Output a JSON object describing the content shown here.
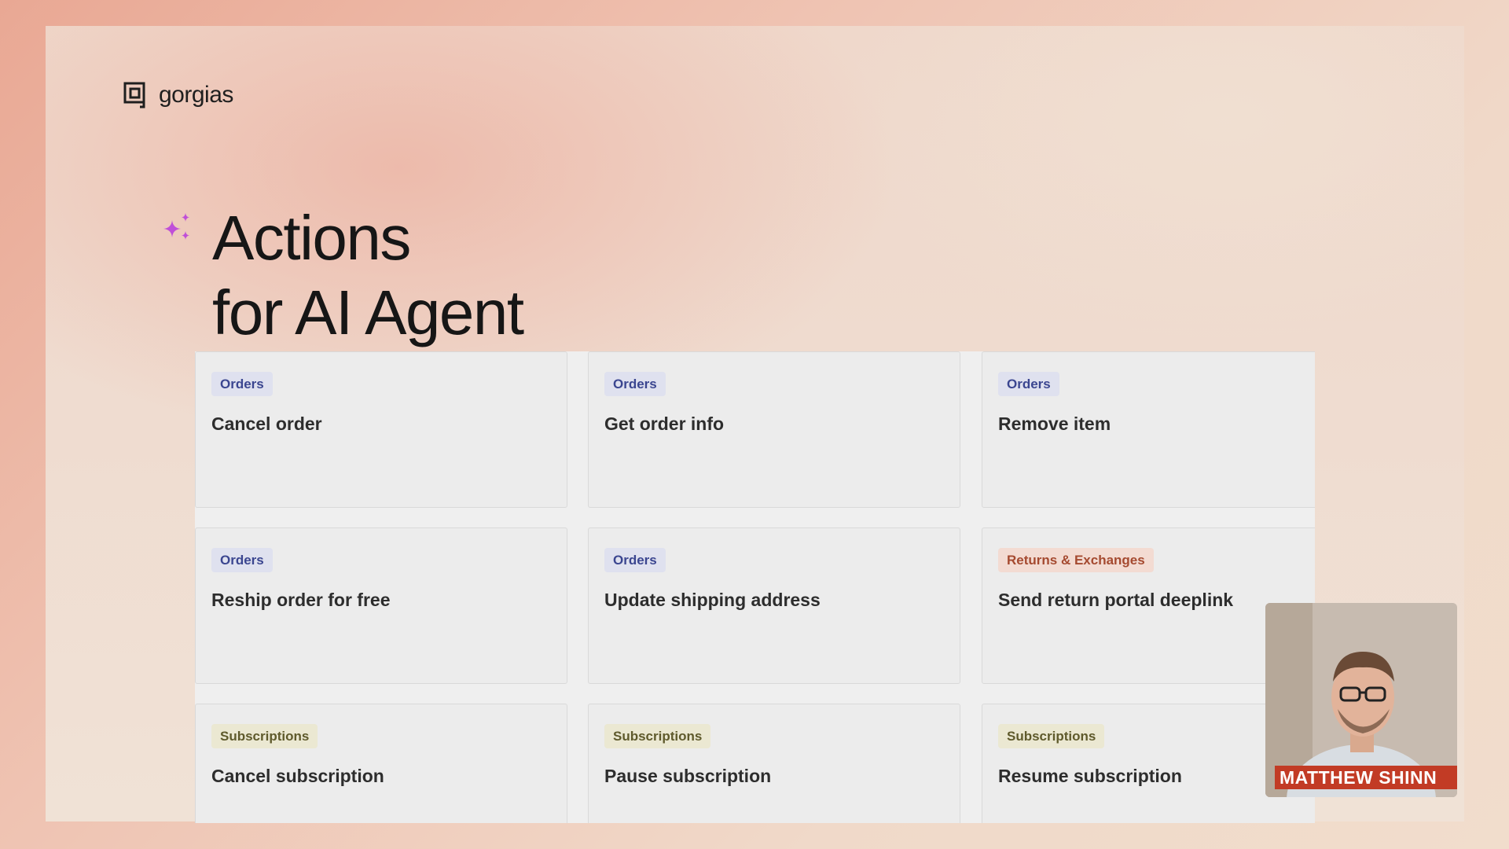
{
  "brand": {
    "name": "gorgias",
    "logo_icon": "gorgias-logo-icon"
  },
  "heading": {
    "line1": "Actions",
    "line2": "for AI Agent",
    "icon": "sparkle-icon"
  },
  "colors": {
    "sparkle": "#c04fd8",
    "tag_orders_bg": "#dfe1ef",
    "tag_orders_fg": "#3b4690",
    "tag_returns_bg": "#f3dbd2",
    "tag_returns_fg": "#a54a30",
    "tag_subs_bg": "#ebe8d2",
    "tag_subs_fg": "#5f5a2c",
    "name_banner": "#c23b25"
  },
  "cards": [
    {
      "tag": "Orders",
      "title": "Cancel order"
    },
    {
      "tag": "Orders",
      "title": "Get order info"
    },
    {
      "tag": "Orders",
      "title": "Remove item"
    },
    {
      "tag": "Orders",
      "title": "Reship order for free"
    },
    {
      "tag": "Orders",
      "title": "Update shipping address"
    },
    {
      "tag": "Returns & Exchanges",
      "title": "Send return portal deeplink"
    },
    {
      "tag": "Subscriptions",
      "title": "Cancel subscription"
    },
    {
      "tag": "Subscriptions",
      "title": "Pause subscription"
    },
    {
      "tag": "Subscriptions",
      "title": "Resume subscription"
    }
  ],
  "webcam": {
    "name": "MATTHEW SHINN"
  }
}
